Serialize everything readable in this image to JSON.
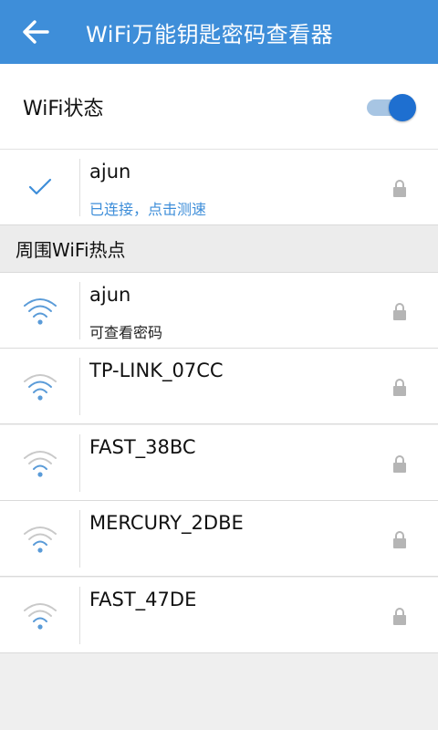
{
  "app_bar": {
    "back_icon": "arrow-left-icon",
    "title": "WiFi万能钥匙密码查看器"
  },
  "wifi_status": {
    "label": "WiFi状态",
    "enabled": true
  },
  "connected_network": {
    "name": "ajun",
    "status": "已连接，点击测速",
    "icon": "check-icon",
    "locked": true
  },
  "nearby": {
    "header": "周围WiFi热点",
    "networks": [
      {
        "name": "ajun",
        "subtitle": "可查看密码",
        "signal": "strong",
        "locked": true
      },
      {
        "name": "TP-LINK_07CC",
        "subtitle": "",
        "signal": "medium",
        "locked": true
      },
      {
        "name": "FAST_38BC",
        "subtitle": "",
        "signal": "weak",
        "locked": true
      },
      {
        "name": "MERCURY_2DBE",
        "subtitle": "",
        "signal": "weak",
        "locked": true
      },
      {
        "name": "FAST_47DE",
        "subtitle": "",
        "signal": "weak",
        "locked": true
      }
    ]
  },
  "colors": {
    "app_bar": "#3e8ed9",
    "accent": "#1e6fd0",
    "connected_text": "#3e8ed9",
    "background": "#efefef"
  }
}
